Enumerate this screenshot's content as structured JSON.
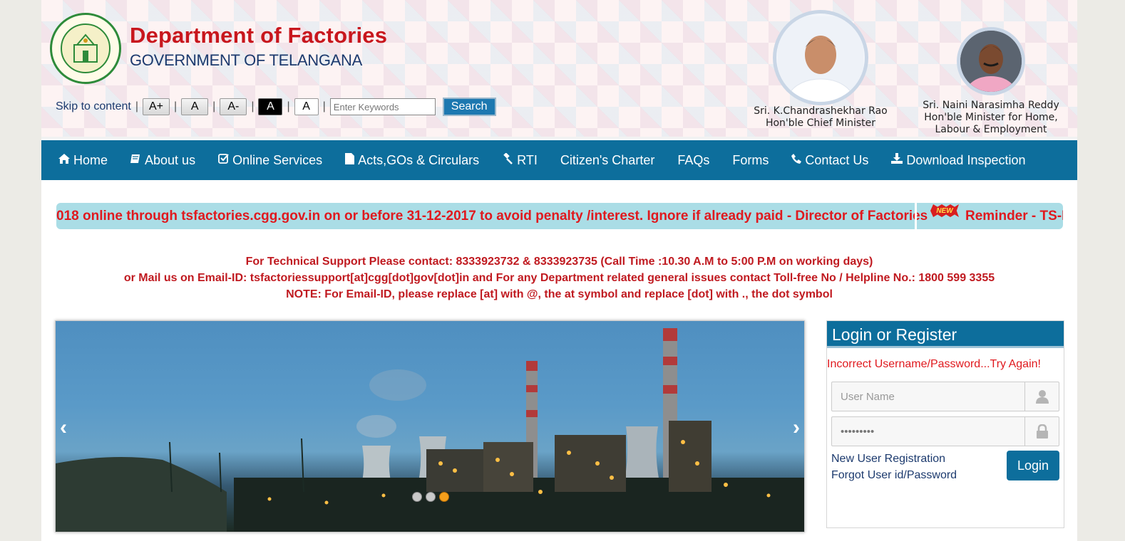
{
  "header": {
    "title": "Department of Factories",
    "subtitle": "GOVERNMENT OF TELANGANA"
  },
  "toolbar": {
    "skip_link": "Skip to content",
    "font_increase": "A+",
    "font_normal": "A",
    "font_decrease": "A-",
    "contrast_dark": "A",
    "contrast_light": "A",
    "search_placeholder": "Enter Keywords",
    "search_button": "Search"
  },
  "officials": [
    {
      "name": "Sri. K.Chandrashekhar Rao",
      "role": "Hon'ble Chief Minister"
    },
    {
      "name": "Sri. Naini Narasimha Reddy",
      "role_line1": "Hon'ble Minister for Home,",
      "role_line2": "Labour & Employment"
    }
  ],
  "nav": {
    "items": [
      {
        "label": "Home",
        "icon": "home-icon"
      },
      {
        "label": "About us",
        "icon": "book-icon"
      },
      {
        "label": "Online Services",
        "icon": "check-square-icon"
      },
      {
        "label": "Acts,GOs & Circulars",
        "icon": "file-icon"
      },
      {
        "label": "RTI",
        "icon": "gavel-icon"
      },
      {
        "label": "Citizen's Charter"
      },
      {
        "label": "FAQs"
      },
      {
        "label": "Forms"
      },
      {
        "label": "Contact Us",
        "icon": "phone-icon"
      },
      {
        "label": "Download Inspection",
        "icon": "download-icon"
      }
    ]
  },
  "marquee": {
    "text1": "018 online through tsfactories.cgg.gov.in on or before 31-12-2017 to avoid penalty /interest. Ignore if already paid - Director of Factories",
    "badge": "NEW",
    "text2": "Reminder - TS-F"
  },
  "notice": {
    "line1": "For Technical Support Please contact: 8333923732 & 8333923735 (Call Time :10.30 A.M to 5:00 P.M on working days)",
    "line2": "or Mail us on Email-ID: tsfactoriessupport[at]cgg[dot]gov[dot]in and For any Department related general issues contact Toll-free No / Helpline No.: 1800 599 3355",
    "line3": "NOTE: For Email-ID, please replace [at] with @, the at symbol and replace [dot] with ., the dot symbol"
  },
  "slider": {
    "prev": "‹",
    "next": "›",
    "slide_count": 3,
    "active_slide": 3
  },
  "login": {
    "title": "Login or Register",
    "error": "Incorrect Username/Password...Try Again!",
    "username_placeholder": "User Name",
    "password_value": "•••••••••",
    "register_link": "New User Registration",
    "forgot_link": "Forgot User id/Password",
    "login_button": "Login"
  },
  "colors": {
    "brand_red": "#c8161d",
    "nav_blue": "#0d6e9c",
    "alert_red": "#e0191e",
    "marquee_bg": "#aadde6"
  }
}
